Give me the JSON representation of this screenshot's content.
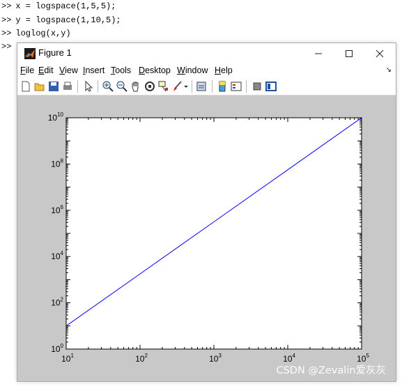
{
  "console": {
    "prompt": ">>",
    "lines": [
      "x = logspace(1,5,5);",
      "y = logspace(1,10,5);",
      "loglog(x,y)",
      ""
    ]
  },
  "window": {
    "title": "Figure 1",
    "minimize_icon": "minimize-icon",
    "maximize_icon": "maximize-icon",
    "close_icon": "close-icon"
  },
  "menubar": {
    "items": [
      {
        "mnemonic": "F",
        "rest": "ile"
      },
      {
        "mnemonic": "E",
        "rest": "dit"
      },
      {
        "mnemonic": "V",
        "rest": "iew"
      },
      {
        "mnemonic": "I",
        "rest": "nsert"
      },
      {
        "mnemonic": "T",
        "rest": "ools"
      },
      {
        "mnemonic": "D",
        "rest": "esktop"
      },
      {
        "mnemonic": "W",
        "rest": "indow"
      },
      {
        "mnemonic": "H",
        "rest": "elp"
      }
    ],
    "dock_icon": "dock-arrow-icon"
  },
  "toolbar": {
    "buttons": [
      "new-figure-icon",
      "open-file-icon",
      "save-figure-icon",
      "print-figure-icon",
      "edit-plot-arrow-icon",
      "zoom-in-icon",
      "zoom-out-icon",
      "pan-hand-icon",
      "rotate-3d-icon",
      "data-cursor-icon",
      "brush-icon",
      "link-plot-icon",
      "insert-colorbar-icon",
      "insert-legend-icon",
      "hide-plot-tools-icon",
      "show-plot-tools-icon"
    ]
  },
  "chart_data": {
    "type": "line",
    "xscale": "log",
    "yscale": "log",
    "xlim": [
      10,
      100000
    ],
    "ylim": [
      1,
      10000000000
    ],
    "x_ticks": [
      {
        "base": "10",
        "exp": "1"
      },
      {
        "base": "10",
        "exp": "2"
      },
      {
        "base": "10",
        "exp": "3"
      },
      {
        "base": "10",
        "exp": "4"
      },
      {
        "base": "10",
        "exp": "5"
      }
    ],
    "y_ticks": [
      {
        "base": "10",
        "exp": "0"
      },
      {
        "base": "10",
        "exp": "2"
      },
      {
        "base": "10",
        "exp": "4"
      },
      {
        "base": "10",
        "exp": "6"
      },
      {
        "base": "10",
        "exp": "8"
      },
      {
        "base": "10",
        "exp": "10"
      }
    ],
    "series": [
      {
        "x": [
          10,
          100,
          1000,
          10000,
          100000
        ],
        "y": [
          10,
          1778.28,
          316227.8,
          56234132.5,
          10000000000
        ],
        "color": "#0000ff"
      }
    ],
    "title": "",
    "xlabel": "",
    "ylabel": "",
    "grid": false
  },
  "watermark": "CSDN @Zevalin爱灰灰",
  "colors": {
    "line": "#0000ff",
    "figure_bg": "#c8c8c8",
    "axes_bg": "#ffffff"
  }
}
